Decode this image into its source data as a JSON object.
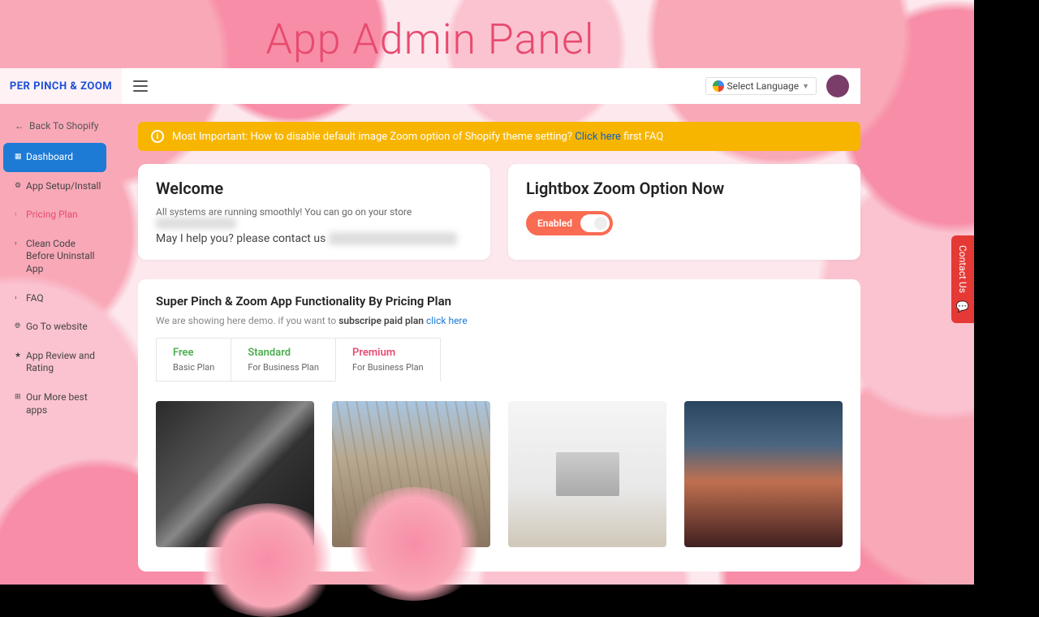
{
  "hero_title": "App Admin Panel",
  "logo_text": "PER PINCH & ZOOM",
  "topbar": {
    "language_label": "Select Language"
  },
  "sidebar": {
    "back_label": "Back To Shopify",
    "items": [
      {
        "label": "Dashboard",
        "active": true
      },
      {
        "label": "App Setup/Install"
      },
      {
        "label": "Pricing Plan",
        "highlight": true
      },
      {
        "label": "Clean Code Before Uninstall App"
      },
      {
        "label": "FAQ"
      },
      {
        "label": "Go To website"
      },
      {
        "label": "App Review and Rating"
      },
      {
        "label": "Our More best apps"
      }
    ]
  },
  "alert": {
    "prefix": "Most Important: How to disable default image Zoom option of Shopify theme setting? ",
    "link_text": "Click here",
    "suffix": " first FAQ"
  },
  "welcome": {
    "title": "Welcome",
    "line1": "All systems are running smoothly! You can go on your store ",
    "line1_blur": "Hidden Storename",
    "line2": "May I help you? please contact us ",
    "line2_blur": "app.example@gmail.com"
  },
  "lightbox": {
    "title": "Lightbox Zoom Option Now",
    "toggle_label": "Enabled"
  },
  "functionality": {
    "title": "Super Pinch & Zoom App Functionality By Pricing Plan",
    "desc_prefix": "We are showing here demo. if you want to ",
    "desc_bold": "subscripe paid plan",
    "desc_link": "click here",
    "tabs": [
      {
        "title": "Free",
        "sub": "Basic Plan"
      },
      {
        "title": "Standard",
        "sub": "For Business Plan"
      },
      {
        "title": "Premium",
        "sub": "For Business Plan"
      }
    ]
  },
  "contact_tab": "Contact Us",
  "colors": {
    "accent_pink": "#e84a6f",
    "alert_bg": "#f8b500",
    "toggle_bg": "#f96b52",
    "active_nav": "#1d7bd6",
    "contact_red": "#e53935",
    "tab_green": "#4caf50"
  }
}
